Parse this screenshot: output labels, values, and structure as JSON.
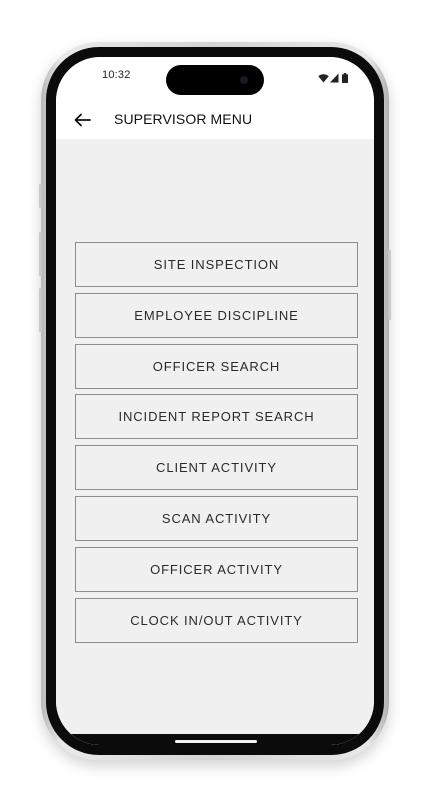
{
  "status_bar": {
    "time": "10:32",
    "icons": [
      "wifi-icon",
      "cellular-signal-icon",
      "battery-icon"
    ]
  },
  "app_bar": {
    "back_icon": "arrow-left-icon",
    "title": "SUPERVISOR MENU"
  },
  "menu": {
    "items": [
      {
        "label": "SITE INSPECTION"
      },
      {
        "label": "EMPLOYEE DISCIPLINE"
      },
      {
        "label": "OFFICER SEARCH"
      },
      {
        "label": "INCIDENT REPORT SEARCH"
      },
      {
        "label": "CLIENT ACTIVITY"
      },
      {
        "label": "SCAN ACTIVITY"
      },
      {
        "label": "OFFICER ACTIVITY"
      },
      {
        "label": "CLOCK IN/OUT ACTIVITY"
      }
    ]
  },
  "colors": {
    "background": "#f0f0f0",
    "app_bar": "#ffffff",
    "button_border": "#8d8d8d",
    "text": "#2a2a2a"
  }
}
